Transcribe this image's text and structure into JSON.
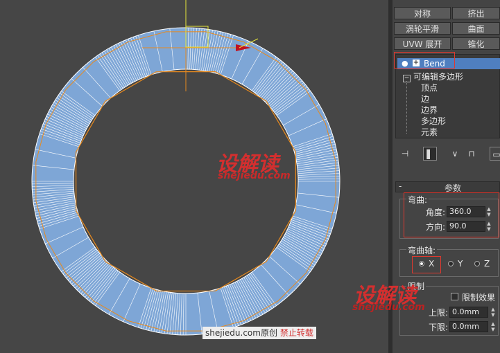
{
  "toolbar_buttons": [
    {
      "label": "对称"
    },
    {
      "label": "挤出"
    },
    {
      "label": "涡轮平滑"
    },
    {
      "label": "曲面"
    },
    {
      "label": "UVW 展开"
    },
    {
      "label": "锥化"
    }
  ],
  "modifier_stack": {
    "selected": "Bend",
    "base_object": "可编辑多边形",
    "subobjects": [
      "顶点",
      "边",
      "边界",
      "多边形",
      "元素"
    ]
  },
  "rollout": {
    "title": "参数",
    "bend_group": {
      "label": "弯曲:",
      "angle_label": "角度:",
      "angle_value": "360.0",
      "direction_label": "方向:",
      "direction_value": "90.0"
    },
    "axis_group": {
      "label": "弯曲轴:",
      "options": [
        "X",
        "Y",
        "Z"
      ],
      "selected": "X"
    },
    "limits_group": {
      "label": "限制",
      "limit_effect_label": "限制效果",
      "upper_label": "上限:",
      "upper_value": "0.0mm",
      "lower_label": "下限:",
      "lower_value": "0.0mm"
    }
  },
  "watermarks": {
    "brand": "设解读",
    "url": "shejiedu.com",
    "footer_site": "shejiedu.com",
    "footer_original": "原创",
    "footer_notice": "禁止转载"
  },
  "colors": {
    "mesh_fill": "#7ea6d6",
    "wire": "#ffffff",
    "orange": "#e88a1e",
    "selection": "#4f7fc0",
    "redbox": "#e0392f"
  }
}
